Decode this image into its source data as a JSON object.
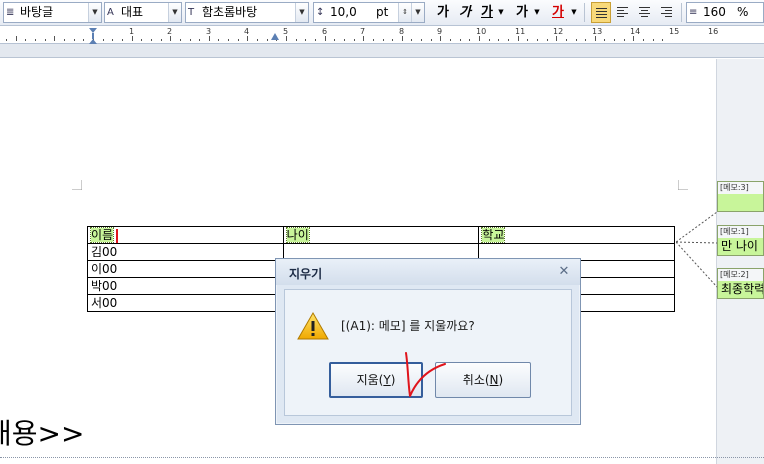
{
  "toolbar": {
    "style_combo": "바탕글",
    "language_combo": "대표",
    "font_combo": "함초롬바탕",
    "size_combo": "10,0",
    "size_unit": "pt",
    "bold_label": "가",
    "italic_label": "가",
    "underline_label": "가",
    "strike_label": "가",
    "color_label": "가",
    "color_accent": "#d40000",
    "line_spacing_combo": "160",
    "line_spacing_unit": "%"
  },
  "ruler": {
    "numbers": [
      "1",
      "2",
      "3",
      "4",
      "5",
      "6",
      "7",
      "8",
      "9",
      "10",
      "11",
      "12",
      "13",
      "14",
      "15",
      "16"
    ]
  },
  "document": {
    "table": {
      "headers": [
        "이름",
        "나이",
        "학교"
      ],
      "rows": [
        [
          "김00",
          "",
          ""
        ],
        [
          "이00",
          "",
          ""
        ],
        [
          "박00",
          "",
          ""
        ],
        [
          "서00",
          "",
          ""
        ]
      ]
    },
    "big_text": "내용>>"
  },
  "memos": [
    {
      "head": "[메모:3]",
      "body": ""
    },
    {
      "head": "[메모:1]",
      "body": "만 나이"
    },
    {
      "head": "[메모:2]",
      "body": "최종학력"
    }
  ],
  "dialog": {
    "title": "지우기",
    "message": "[(A1): 메모] 를 지울까요?",
    "confirm_label": "지움(",
    "confirm_key": "Y",
    "cancel_label": "취소(",
    "cancel_key": "N",
    "close_glyph": "✕"
  },
  "colors": {
    "memo_highlight": "#c8f59a",
    "annotation_red": "#e0141c"
  }
}
